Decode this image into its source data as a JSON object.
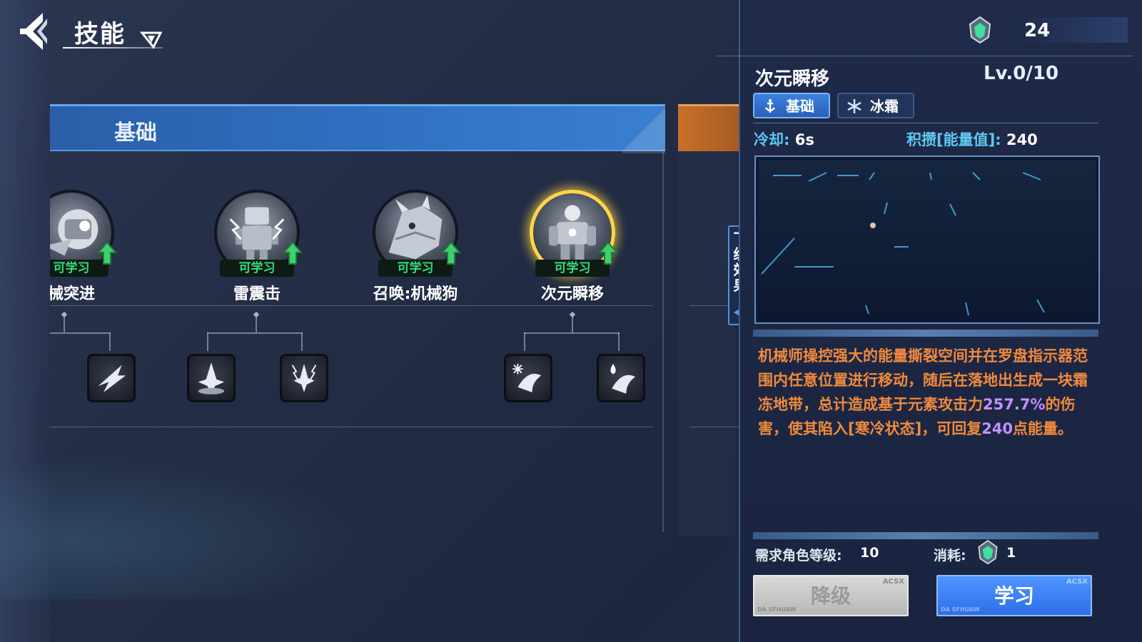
{
  "header": {
    "title": "技能"
  },
  "currency": {
    "icon": "energy-crystal-icon",
    "value": "24"
  },
  "tree": {
    "category_label": "基础",
    "skills": [
      {
        "name": "机械突进",
        "visible_name": "械突进",
        "badge": "可学习",
        "badge_visible": "可学习",
        "selected": false
      },
      {
        "name": "雷震击",
        "badge": "可学习",
        "selected": false
      },
      {
        "name": "召唤:机械狗",
        "badge": "可学习",
        "selected": false
      },
      {
        "name": "次元瞬移",
        "badge": "可学习",
        "selected": true
      }
    ],
    "side_tab_label": "下级效果"
  },
  "detail": {
    "skill_name": "次元瞬移",
    "level": "Lv.0/10",
    "tags": [
      {
        "label": "基础",
        "icon": "anchor-icon",
        "active": true
      },
      {
        "label": "冰霜",
        "icon": "snowflake-icon",
        "active": false
      }
    ],
    "cooldown_label": "冷却:",
    "cooldown_value": "6s",
    "energy_label": "积攒[能量值]:",
    "energy_value": "240",
    "description": {
      "p1": "机械师操控强大的能量撕裂空间并在罗盘指示器范围内任意位置进行移动，随后在落地出生成一块霜冻地带，总计造成基于元素攻击力",
      "p2": "257.7%",
      "p3": "的伤害，使其陷入[寒冷状态]，可回复",
      "p4": "240",
      "p5": "点能量。"
    },
    "requirement_label": "需求角色等级:",
    "requirement_value": "10",
    "cost_label": "消耗:",
    "cost_value": "1",
    "downgrade_button": "降级",
    "learn_button": "学习",
    "button_tag": "ACSX",
    "button_tag2": "DA SFHUAW"
  },
  "colors": {
    "accent_blue": "#3b82e0",
    "learnable_green": "#2fe07a",
    "description_orange": "#f08a3c",
    "highlight_purple": "#c490ff",
    "selected_gold": "#ffd54a"
  }
}
